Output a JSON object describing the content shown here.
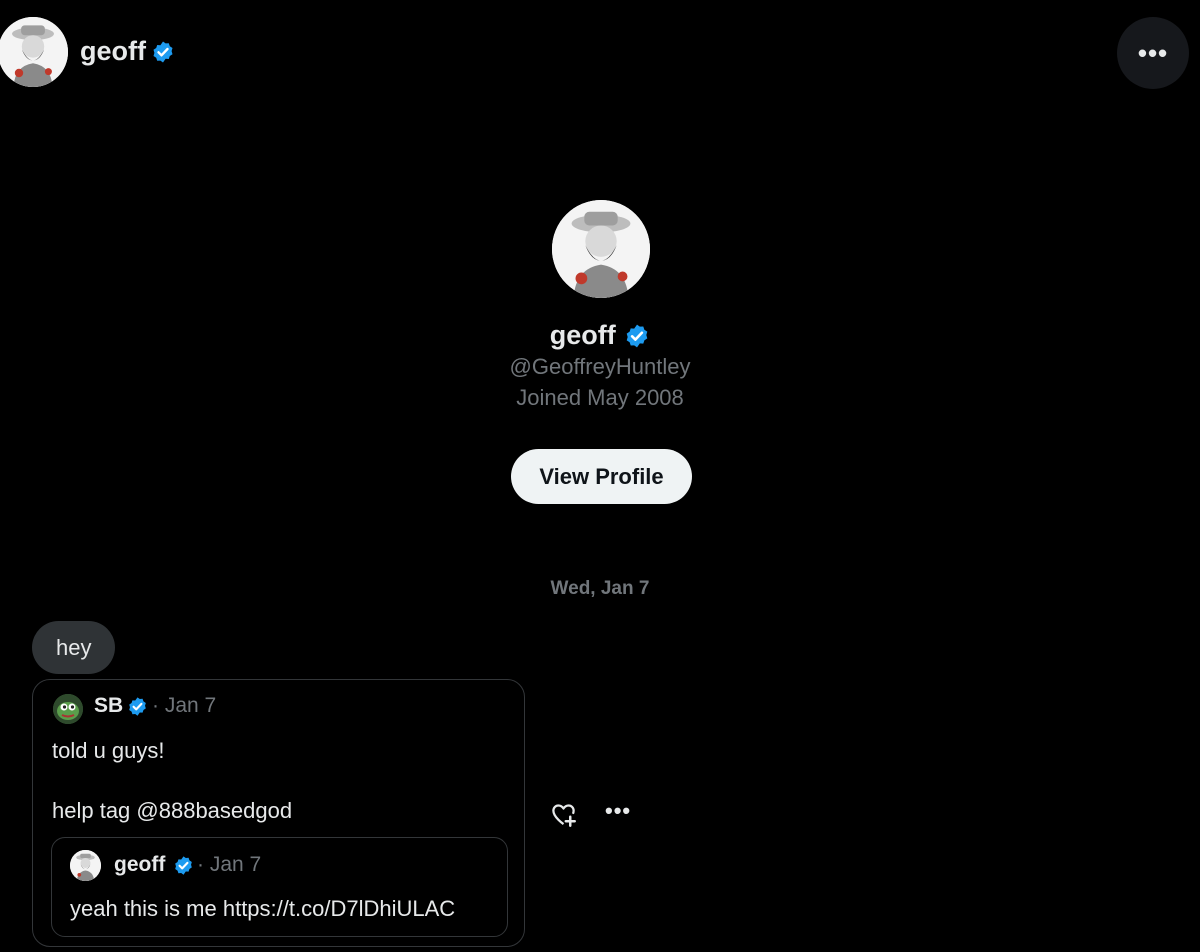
{
  "header": {
    "name": "geoff",
    "more_label": "•••"
  },
  "profile": {
    "name": "geoff",
    "handle": "@GeoffreyHuntley",
    "joined": "Joined May 2008",
    "view_profile_label": "View Profile"
  },
  "conversation": {
    "date_separator": "Wed, Jan 7",
    "message": "hey",
    "quoted_tweet": {
      "author": "SB",
      "date": "· Jan 7",
      "line1": "told u guys!",
      "line2": "help tag @888basedgod",
      "nested": {
        "author": "geoff",
        "date": "· Jan 7",
        "text": "yeah this is me https://t.co/D7lDhiULAC"
      }
    },
    "message_actions_more": "•••"
  },
  "colors": {
    "verified": "#1d9bf0",
    "muted": "#71767b",
    "background": "#000000"
  },
  "icons": [
    "verified-badge-icon",
    "add-reaction-icon",
    "more-icon"
  ]
}
